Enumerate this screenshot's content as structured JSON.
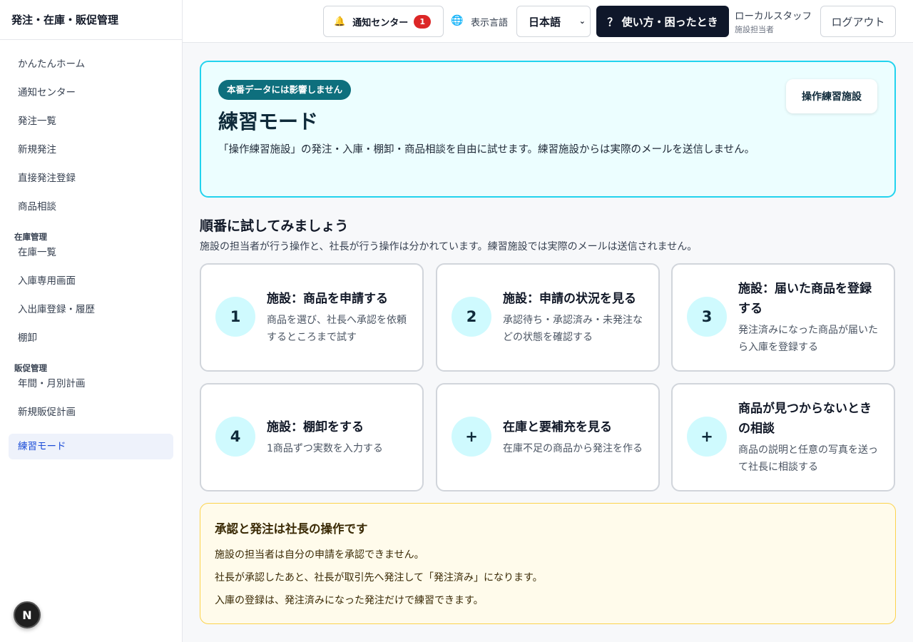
{
  "sidebar": {
    "brand": "発注・在庫・販促管理",
    "group1": [
      "かんたんホーム",
      "通知センター",
      "発注一覧",
      "新規発注",
      "直接発注登録",
      "商品相談"
    ],
    "section_inventory": "在庫管理",
    "group2": [
      "在庫一覧",
      "入庫専用画面",
      "入出庫登録・履歴",
      "棚卸"
    ],
    "section_promo": "販促管理",
    "group3": [
      "年間・月別計画",
      "新規販促計画"
    ],
    "active_item": "練習モード",
    "fab_label": "N"
  },
  "header": {
    "notification_label": "通知センター",
    "notification_count": "1",
    "language_label": "表示言語",
    "language_value": "日本語",
    "help_label": "？ 使い方・困ったとき",
    "user_name": "ローカルスタッフ",
    "user_role": "施設担当者",
    "logout_label": "ログアウト"
  },
  "practice": {
    "pill": "本番データには影響しません",
    "title": "練習モード",
    "description": "「操作練習施設」の発注・入庫・棚卸・商品相談を自由に試せます。練習施設からは実際のメールを送信しません。",
    "facility_button": "操作練習施設"
  },
  "steps": {
    "title": "順番に試してみましょう",
    "subtitle": "施設の担当者が行う操作と、社長が行う操作は分かれています。練習施設では実際のメールは送信されません。",
    "cards": [
      {
        "badge": "1",
        "title": "施設：商品を申請する",
        "desc": "商品を選び、社長へ承認を依頼するところまで試す"
      },
      {
        "badge": "2",
        "title": "施設：申請の状況を見る",
        "desc": "承認待ち・承認済み・未発注などの状態を確認する"
      },
      {
        "badge": "3",
        "title": "施設：届いた商品を登録する",
        "desc": "発注済みになった商品が届いたら入庫を登録する"
      },
      {
        "badge": "4",
        "title": "施設：棚卸をする",
        "desc": "1商品ずつ実数を入力する"
      },
      {
        "badge": "+",
        "title": "在庫と要補充を見る",
        "desc": "在庫不足の商品から発注を作る"
      },
      {
        "badge": "+",
        "title": "商品が見つからないときの相談",
        "desc": "商品の説明と任意の写真を送って社長に相談する"
      }
    ]
  },
  "notice": {
    "title": "承認と発注は社長の操作です",
    "lines": [
      "施設の担当者は自分の申請を承認できません。",
      "社長が承認したあと、社長が取引先へ発注して「発注済み」になります。",
      "入庫の登録は、発注済みになった発注だけで練習できます。"
    ]
  }
}
